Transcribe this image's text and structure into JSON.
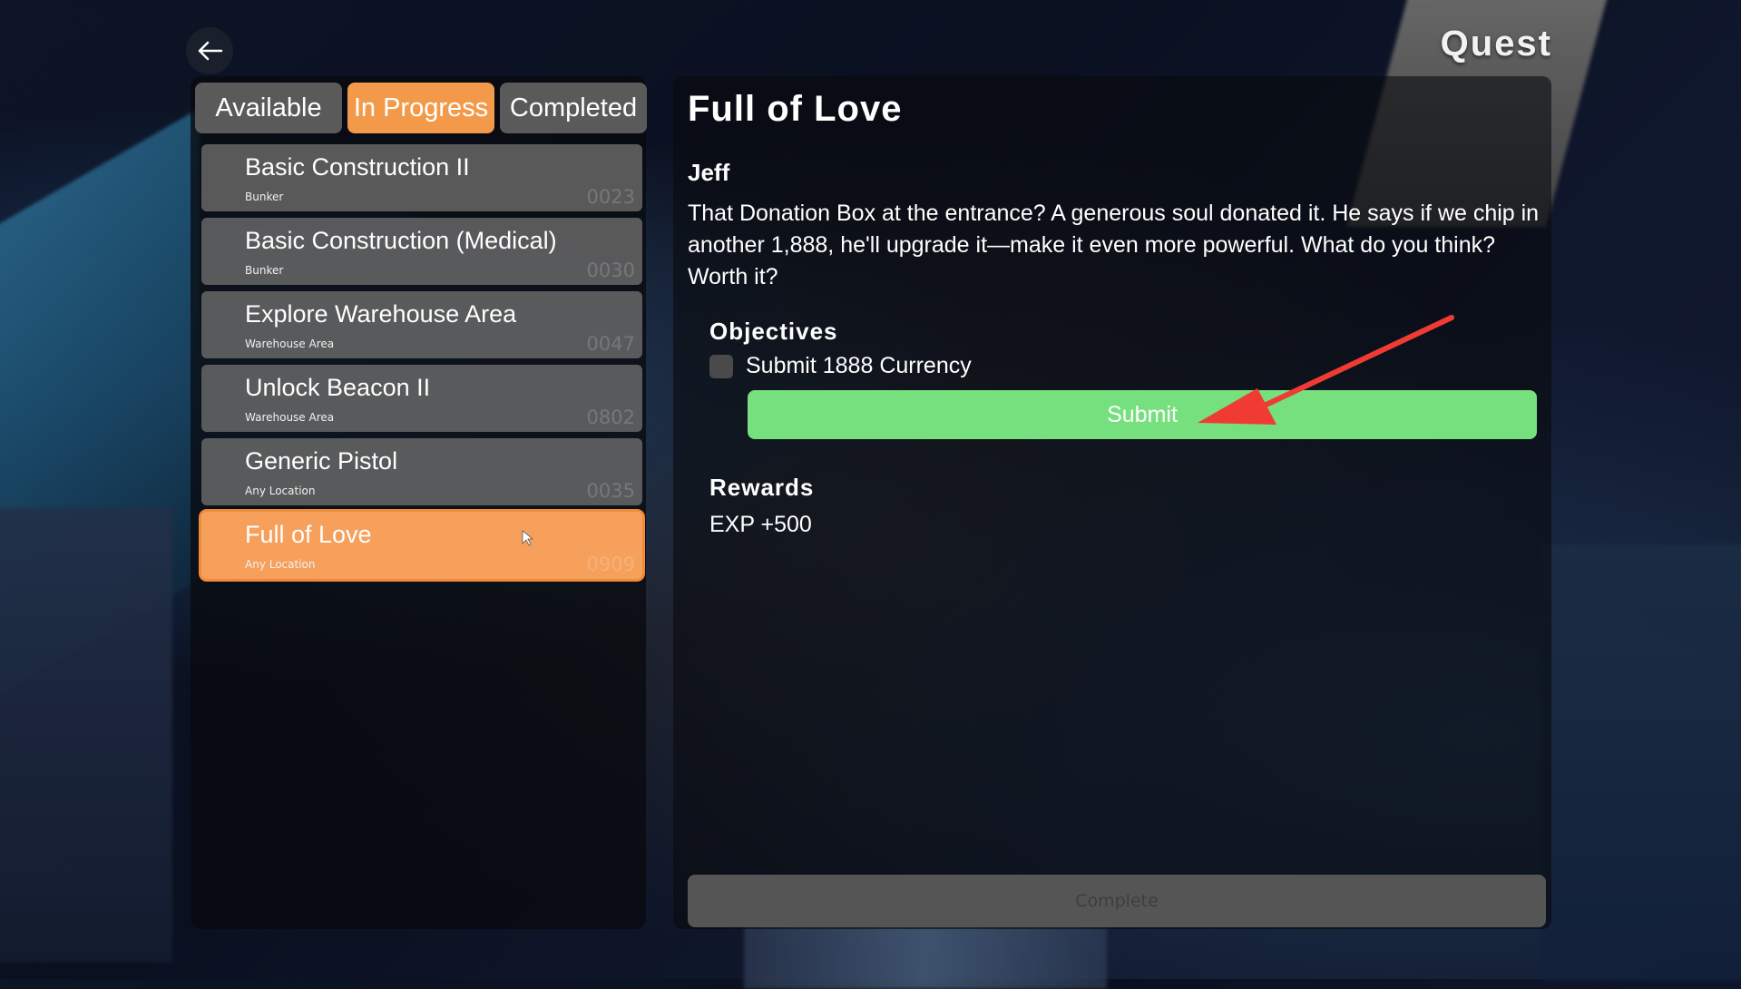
{
  "screen": {
    "title": "Quest"
  },
  "tabs": [
    {
      "label": "Available",
      "active": false
    },
    {
      "label": "In Progress",
      "active": true
    },
    {
      "label": "Completed",
      "active": false
    }
  ],
  "quests": [
    {
      "name": "Basic Construction II",
      "location": "Bunker",
      "id": "0023"
    },
    {
      "name": "Basic Construction (Medical)",
      "location": "Bunker",
      "id": "0030"
    },
    {
      "name": "Explore Warehouse Area",
      "location": "Warehouse Area",
      "id": "0047"
    },
    {
      "name": "Unlock Beacon II",
      "location": "Warehouse Area",
      "id": "0802"
    },
    {
      "name": "Generic Pistol",
      "location": "Any Location",
      "id": "0035"
    },
    {
      "name": "Full of Love",
      "location": "Any Location",
      "id": "0909",
      "selected": true
    }
  ],
  "detail": {
    "title": "Full of Love",
    "npc": "Jeff",
    "dialogue": "That Donation Box at the entrance? A generous soul donated it. He says if we chip in another 1,888, he'll upgrade it—make it even more powerful. What do you think? Worth it?",
    "objectives_label": "Objectives",
    "objectives": [
      {
        "text": "Submit 1888 Currency",
        "done": false
      }
    ],
    "submit_label": "Submit",
    "rewards_label": "Rewards",
    "rewards": [
      "EXP +500"
    ],
    "complete_label": "Complete"
  },
  "colors": {
    "accent": "#f39a4a",
    "submit": "#76e07e",
    "annotation_arrow": "#ef3b34"
  },
  "icons": {
    "back": "arrow-left-icon",
    "cursor": "mouse-pointer-icon",
    "annotation": "red-arrow-annotation"
  }
}
